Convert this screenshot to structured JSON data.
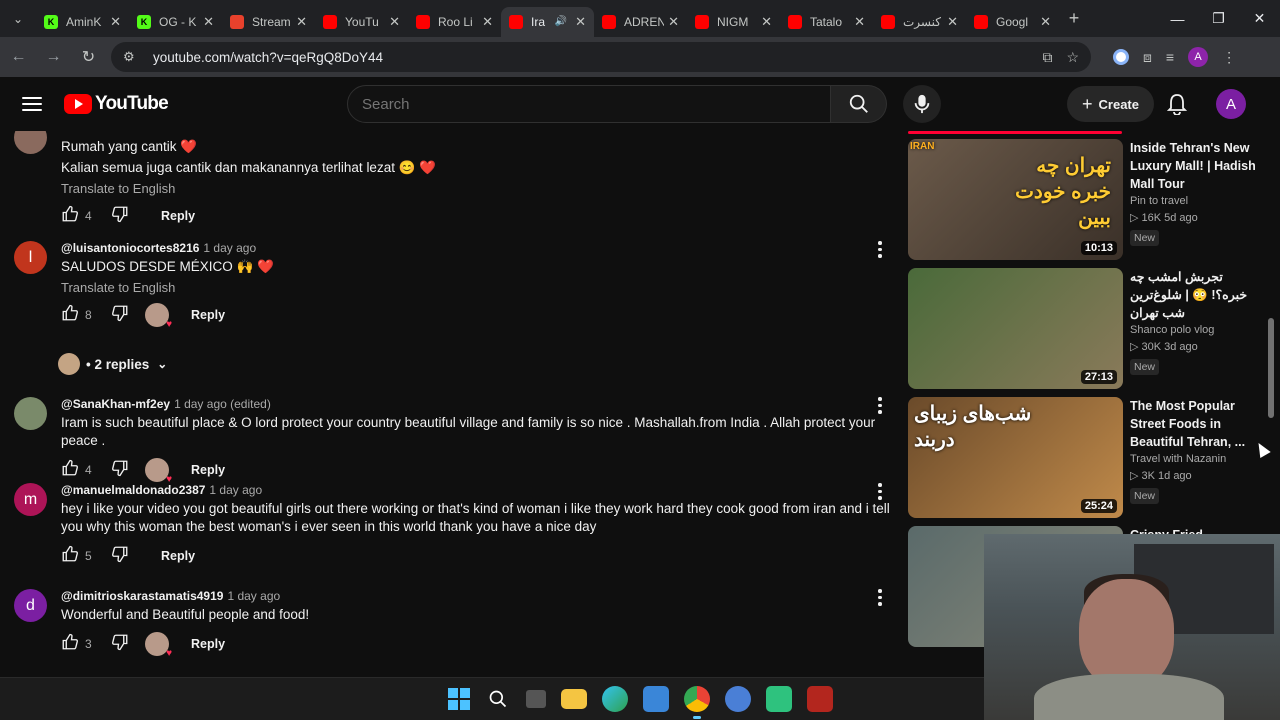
{
  "browser": {
    "tabs": [
      {
        "title": "AminK",
        "favicon_color": "#53fc18",
        "favicon_glyph": "K",
        "active": false
      },
      {
        "title": "OG - K",
        "favicon_color": "#53fc18",
        "favicon_glyph": "K",
        "active": false
      },
      {
        "title": "Stream",
        "favicon_color": "#e8412c",
        "favicon_glyph": "",
        "active": false
      },
      {
        "title": "YouTu",
        "favicon_color": "#ff0000",
        "favicon_glyph": "",
        "active": false
      },
      {
        "title": "Roo Li",
        "favicon_color": "#ff0000",
        "favicon_glyph": "",
        "active": false
      },
      {
        "title": "Ira",
        "favicon_color": "#ff0000",
        "favicon_glyph": "",
        "active": true
      },
      {
        "title": "ADREN",
        "favicon_color": "#ff0000",
        "favicon_glyph": "",
        "active": false
      },
      {
        "title": "NIGM",
        "favicon_color": "#ff0000",
        "favicon_glyph": "",
        "active": false
      },
      {
        "title": "Tatalo",
        "favicon_color": "#ff0000",
        "favicon_glyph": "",
        "active": false
      },
      {
        "title": "کنسرت",
        "favicon_color": "#ff0000",
        "favicon_glyph": "",
        "active": false
      },
      {
        "title": "Googl",
        "favicon_color": "#ff0000",
        "favicon_glyph": "",
        "active": false
      }
    ],
    "url": "youtube.com/watch?v=qeRgQ8DoY44",
    "profile_initial": "A"
  },
  "header": {
    "logo_text": "YouTube",
    "search_placeholder": "Search",
    "create_label": "Create",
    "avatar_initial": "A"
  },
  "comments": [
    {
      "author": "",
      "time": "",
      "lines": [
        "Rumah yang cantik ❤️",
        "Kalian semua juga cantik dan makanannya terlihat lezat 😊 ❤️"
      ],
      "translate": "Translate to English",
      "likes": "4",
      "creator_heart": false,
      "reply_label": "Reply",
      "avatar_initial": "",
      "avatar_color": "#8a6a5e"
    },
    {
      "author": "@luisantoniocortes8216",
      "time": "1 day ago",
      "lines": [
        "SALUDOS DESDE MÉXICO 🙌 ❤️"
      ],
      "translate": "Translate to English",
      "likes": "8",
      "creator_heart": true,
      "reply_label": "Reply",
      "avatar_initial": "l",
      "avatar_color": "#c1351d"
    },
    {
      "author": "@SanaKhan-mf2ey",
      "time": "1 day ago (edited)",
      "lines": [
        "Iram is such beautiful place & O lord protect your country beautiful village and family is so nice . Mashallah.from India . Allah protect your peace ."
      ],
      "translate": "",
      "likes": "4",
      "creator_heart": true,
      "reply_label": "Reply",
      "avatar_initial": "",
      "avatar_color": "#7a8a6a"
    },
    {
      "author": "@manuelmaldonado2387",
      "time": "1 day ago",
      "lines": [
        "hey i like your video you got beautiful girls out there working or that's kind of woman i like they work hard they cook good from iran and i tell you why this woman the best woman's i ever seen in this world thank you have a nice day"
      ],
      "translate": "",
      "likes": "5",
      "creator_heart": false,
      "reply_label": "Reply",
      "avatar_initial": "m",
      "avatar_color": "#ad1457"
    },
    {
      "author": "@dimitrioskarastamatis4919",
      "time": "1 day ago",
      "lines": [
        "Wonderful and Beautiful people and food!"
      ],
      "translate": "",
      "likes": "3",
      "creator_heart": true,
      "reply_label": "Reply",
      "avatar_initial": "d",
      "avatar_color": "#7b1fa2"
    }
  ],
  "replies_toggle": "2 replies",
  "sidebar": {
    "videos": [
      {
        "title": "Inside Tehran's New Luxury Mall! | Hadish Mall Tour",
        "channel": "Pin to travel",
        "stats": "▷ 16K  5d ago",
        "badge": "New",
        "duration": "10:13",
        "thumb_text": "تهران چه خبره خودت ببین",
        "thumb_tag": "IRAN",
        "thumb_colors": [
          "#6b5a4a",
          "#3a3028"
        ]
      },
      {
        "title": "تجربش امشب چه خبره؟! 😳 | شلوغ‌ترین شب تهران",
        "channel": "Shanco polo vlog",
        "stats": "▷ 30K  3d ago",
        "badge": "New",
        "duration": "27:13",
        "thumb_text": "",
        "thumb_tag": "",
        "thumb_colors": [
          "#4a6a3a",
          "#8a7a5a"
        ]
      },
      {
        "title": "The Most Popular Street Foods in Beautiful Tehran, ...",
        "channel": "Travel with Nazanin",
        "stats": "▷ 3K  1d ago",
        "badge": "New",
        "duration": "25:24",
        "thumb_text": "شب‌های زیبای دربند",
        "thumb_tag": "",
        "thumb_colors": [
          "#6a4a2a",
          "#c08a4a"
        ]
      },
      {
        "title": "Crispy Fried Eggplant",
        "channel": "",
        "stats": "",
        "badge": "",
        "duration": "",
        "thumb_text": "",
        "thumb_tag": "",
        "thumb_colors": [
          "#5a6a6a",
          "#8a8a7a"
        ]
      }
    ]
  }
}
